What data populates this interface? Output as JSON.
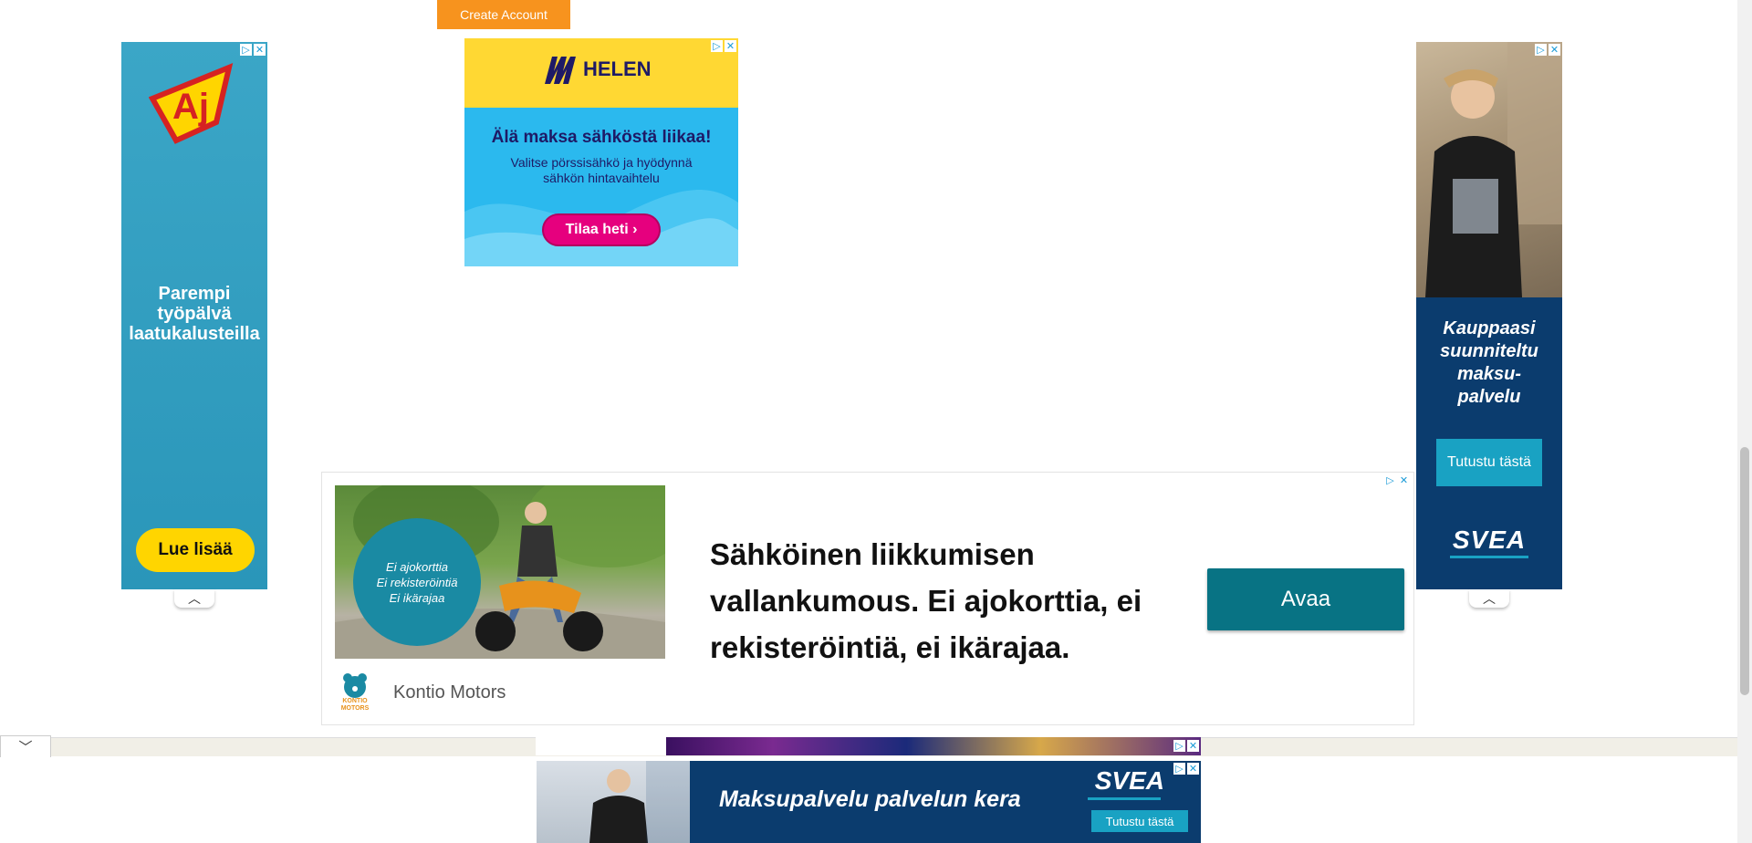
{
  "header": {
    "create_account_label": "Create Account"
  },
  "ad_choices": {
    "play_glyph": "▷",
    "close_glyph": "✕"
  },
  "ad_left": {
    "brand": "Aj",
    "text_line1": "Parempi",
    "text_line2": "työpälvä",
    "text_line3": "laatukalusteilla",
    "button_label": "Lue lisää"
  },
  "ad_helen": {
    "brand": "HELEN",
    "headline": "Älä maksa sähköstä liikaa!",
    "subtext": "Valitse pörssisähkö ja hyödynnä sähkön hintavaihtelu",
    "button_label": "Tilaa heti ›"
  },
  "ad_right": {
    "text_line1": "Kauppaasi",
    "text_line2": "suunniteltu",
    "text_line3": "maksu-",
    "text_line4": "palvelu",
    "button_label": "Tutustu tästä",
    "brand": "SVEA"
  },
  "ad_kontio": {
    "badge_line1": "Ei ajokorttia",
    "badge_line2": "Ei rekisteröintiä",
    "badge_line3": "Ei ikärajaa",
    "headline": "Sähköinen liikkumisen vallankumous. Ei ajokorttia, ei rekisteröintiä, ei ikärajaa.",
    "button_label": "Avaa",
    "logo_label": "KONTIO MOTORS",
    "advertiser": "Kontio Motors"
  },
  "ad_bottom": {
    "text": "Maksupalvelu palvelun kera",
    "brand": "SVEA",
    "button_label": "Tutustu tästä"
  },
  "icons": {
    "chevron_up": "︿",
    "chevron_down": "﹀"
  },
  "colors": {
    "create_account": "#f7931e",
    "aj_blue": "#2a96b9",
    "helen_yellow": "#ffd833",
    "helen_pink": "#e6007e",
    "svea_navy": "#0b3c6e",
    "kontio_teal": "#087384"
  }
}
